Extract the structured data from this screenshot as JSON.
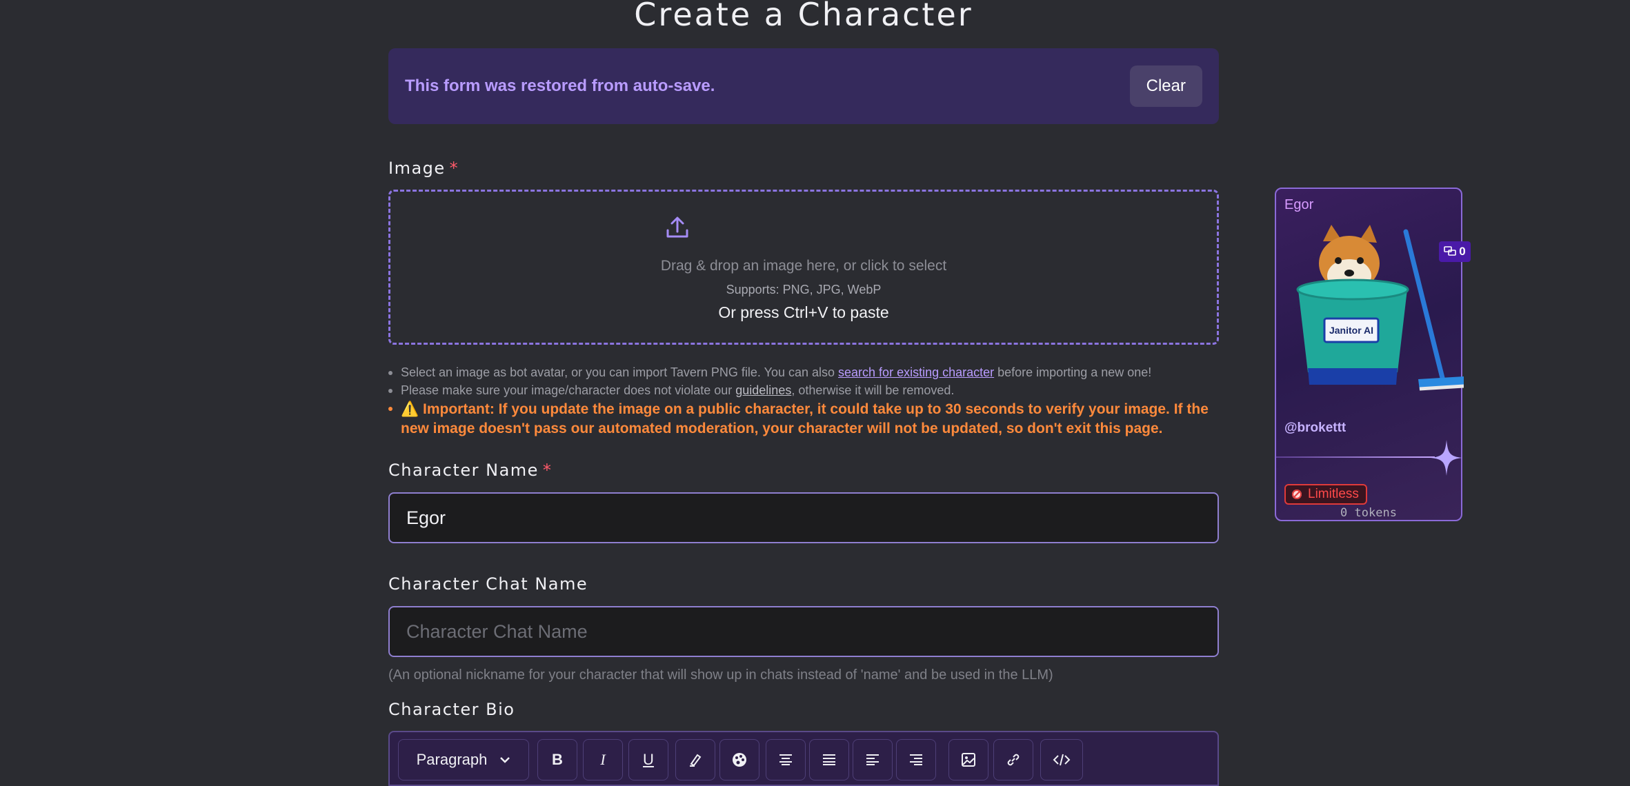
{
  "page": {
    "title": "Create a Character"
  },
  "banner": {
    "message": "This form was restored from auto-save.",
    "clear_label": "Clear"
  },
  "image_section": {
    "label": "Image",
    "required_mark": "*",
    "dropzone": {
      "main_text": "Drag & drop an image here, or click to select",
      "supports_text": "Supports: PNG, JPG, WebP",
      "paste_text": "Or press Ctrl+V to paste"
    },
    "notes": {
      "note1_before": "Select an image as bot avatar, or you can import Tavern PNG file. You can also ",
      "note1_link": "search for existing character",
      "note1_after": " before importing a new one!",
      "note2_before": "Please make sure your image/character does not violate our ",
      "note2_link": "guidelines",
      "note2_after": ", otherwise it will be removed.",
      "warning_icon": "⚠️",
      "warning_label": "Important:",
      "warning_text": " If you update the image on a public character, it could take up to 30 seconds to verify your image. If the new image doesn't pass our automated moderation, your character will not be updated, so don't exit this page."
    }
  },
  "name_field": {
    "label": "Character Name",
    "required_mark": "*",
    "value": "Egor"
  },
  "chat_name_field": {
    "label": "Character Chat Name",
    "placeholder": "Character Chat Name",
    "help": "(An optional nickname for your character that will show up in chats instead of 'name' and be used in the LLM)"
  },
  "bio_field": {
    "label": "Character Bio",
    "toolbar": {
      "block_type": "Paragraph",
      "bold": "B",
      "italic": "I",
      "underline": "U",
      "buttons": [
        "highlight-icon",
        "palette-icon",
        "align-left-icon",
        "align-justify-icon",
        "align-center-icon",
        "align-right-icon",
        "image-icon",
        "link-icon",
        "code-icon"
      ]
    }
  },
  "preview_card": {
    "name": "Egor",
    "chat_count": "0",
    "image_label": "Janitor AI",
    "author": "@brokettt",
    "badge": "Limitless",
    "tokens": "0 tokens"
  },
  "colors": {
    "accent": "#8b74e0",
    "banner_text": "#b99cff",
    "warning": "#ff8a3c",
    "required": "#ff5a6a"
  }
}
